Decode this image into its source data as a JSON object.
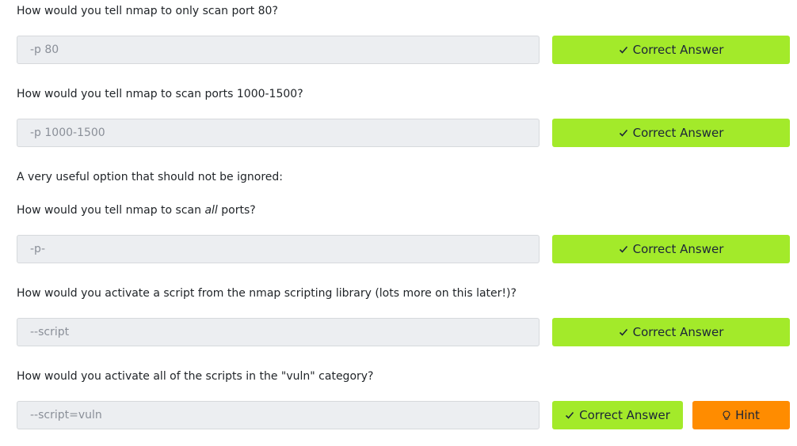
{
  "questions": [
    {
      "text": "How would you tell nmap to only scan port 80?",
      "answer": "-p 80",
      "button": "Correct Answer"
    },
    {
      "text": "How would you tell nmap to scan ports 1000-1500?",
      "answer": "-p 1000-1500",
      "button": "Correct Answer"
    },
    {
      "note": "A very useful option that should not be ignored:",
      "text_before": "How would you tell nmap to scan ",
      "text_em": "all",
      "text_after": " ports?",
      "answer": "-p-",
      "button": "Correct Answer"
    },
    {
      "text": "How would you activate a script from the nmap scripting library (lots more on this later!)?",
      "answer": "--script",
      "button": "Correct Answer"
    },
    {
      "text": "How would you activate all of the scripts in the \"vuln\" category?",
      "answer": "--script=vuln",
      "button": "Correct Answer",
      "hint": "Hint"
    }
  ],
  "icons": {
    "correct": "check-icon",
    "hint": "lightbulb-icon"
  },
  "colors": {
    "correct_button": "#a3ea2a",
    "hint_button": "#ff8c00",
    "input_background": "#eceef1"
  }
}
